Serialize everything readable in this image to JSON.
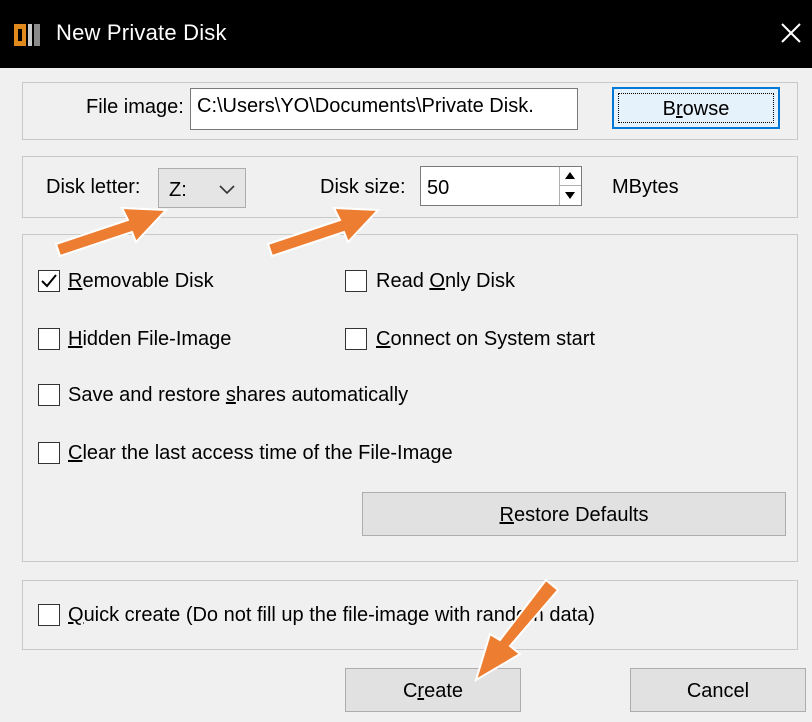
{
  "window": {
    "title": "New Private Disk"
  },
  "file_image": {
    "label": "File image:",
    "value": "C:\\Users\\YO\\Documents\\Private Disk.",
    "browse_pre": "B",
    "browse_u": "r",
    "browse_post": "owse"
  },
  "disk": {
    "letter_label": "Disk letter:",
    "letter_value": "Z:",
    "size_label": "Disk size:",
    "size_value": "50",
    "size_unit": "MBytes"
  },
  "options": {
    "removable": {
      "u": "R",
      "rest": "emovable Disk",
      "checked": true
    },
    "read_only": {
      "pre": "Read ",
      "u": "O",
      "rest": "nly Disk",
      "checked": false
    },
    "hidden": {
      "u": "H",
      "rest": "idden File-Image",
      "checked": false
    },
    "connect": {
      "u": "C",
      "rest": "onnect on System start",
      "checked": false
    },
    "save_restore": {
      "pre": "Save and restore ",
      "u": "s",
      "rest": "hares automatically",
      "checked": false
    },
    "clear_access": {
      "u": "C",
      "rest": "lear the last access time of the File-Image",
      "checked": false
    },
    "restore_defaults": {
      "u": "R",
      "rest": "estore Defaults"
    }
  },
  "quick": {
    "u": "Q",
    "rest": "uick create (Do not fill up the file-image with random data)",
    "checked": false
  },
  "footer": {
    "create_pre": "C",
    "create_u": "r",
    "create_post": "eate",
    "cancel": "Cancel"
  },
  "colors": {
    "arrow": "#ed7d31",
    "focus_border": "#0078d7"
  }
}
